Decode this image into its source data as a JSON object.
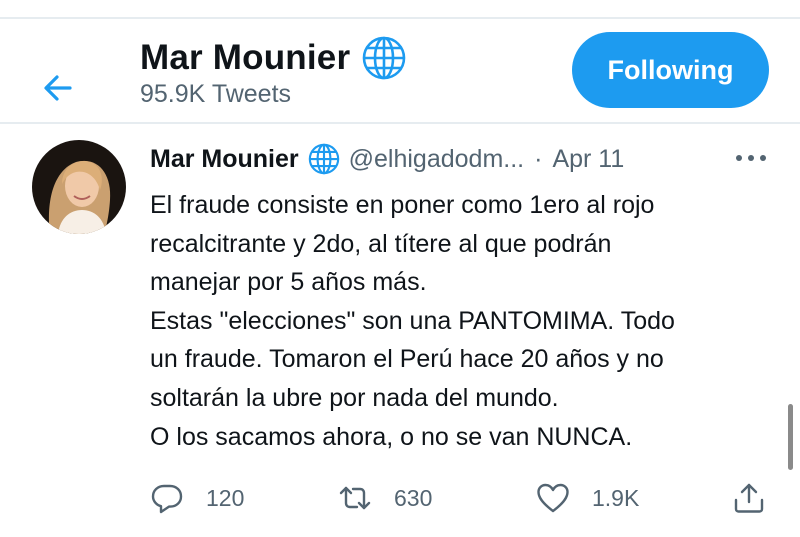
{
  "header": {
    "back_icon": "arrow-left-icon",
    "profile_name": "Mar Mounier",
    "verified_icon": "globe-icon",
    "tweet_count": "95.9K Tweets",
    "follow_label": "Following"
  },
  "tweet": {
    "author_name": "Mar Mounier",
    "handle": "@elhigadodm...",
    "separator": "·",
    "date": "Apr 11",
    "more_icon": "ellipsis-icon",
    "lines": [
      "El fraude consiste en poner como 1ero al rojo",
      "recalcitrante y 2do, al títere al que podrán",
      "manejar por 5 años más.",
      "Estas \"elecciones\" son una PANTOMIMA. Todo",
      "un fraude. Tomaron el Perú hace 20 años y no",
      "soltarán la ubre por nada del mundo.",
      "O los sacamos ahora, o no se van NUNCA."
    ],
    "actions": {
      "reply_count": "120",
      "retweet_count": "630",
      "like_count": "1.9K"
    }
  },
  "colors": {
    "accent": "#1d9bf0",
    "text": "#0f1419",
    "secondary_text": "#536471",
    "divider": "#e6ecf0"
  }
}
